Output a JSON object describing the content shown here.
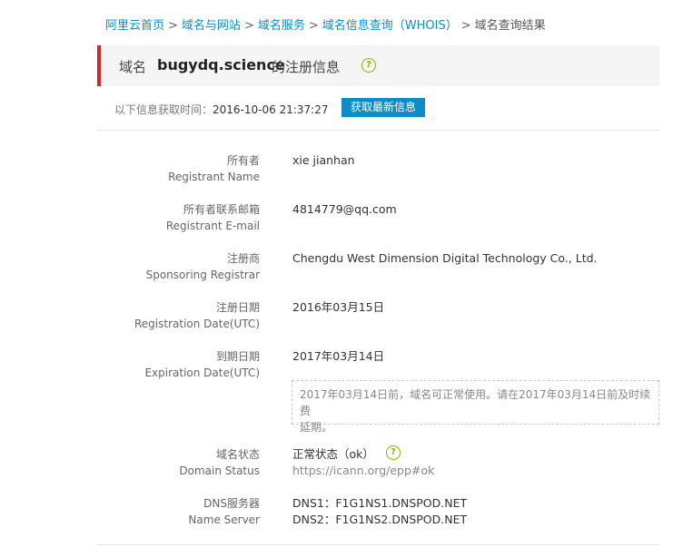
{
  "breadcrumb": {
    "items": [
      "阿里云首页",
      "域名与网站",
      "域名服务",
      "域名信息查询（WHOIS）"
    ],
    "separator": ">",
    "current": "域名查询结果"
  },
  "title": {
    "prefix": "域名",
    "domain": "bugydq.science",
    "suffix": "的注册信息",
    "help_icon": "question-circle-icon"
  },
  "fetch": {
    "label": "以下信息获取时间：",
    "time": "2016-10-06 21:37:27",
    "button": "获取最新信息"
  },
  "registrant": {
    "label_cn": "所有者",
    "label_en": "Registrant Name",
    "value": "xie jianhan"
  },
  "email": {
    "label_cn": "所有者联系邮箱",
    "label_en": "Registrant E-mail",
    "value": "4814779@qq.com"
  },
  "registrar": {
    "label_cn": "注册商",
    "label_en": "Sponsoring Registrar",
    "value": "Chengdu West Dimension Digital Technology Co., Ltd."
  },
  "reg_date": {
    "label_cn": "注册日期",
    "label_en": "Registration Date(UTC)",
    "value": "2016年03月15日"
  },
  "exp_date": {
    "label_cn": "到期日期",
    "label_en": "Expiration Date(UTC)",
    "value": "2017年03月14日",
    "notice_line1": "2017年03月14日前，域名可正常使用。请在2017年03月14日前及时续费",
    "notice_line2": "延期。"
  },
  "status": {
    "label_cn": "域名状态",
    "label_en": "Domain Status",
    "value": "正常状态（ok）",
    "link": "https://icann.org/epp#ok",
    "help_icon": "question-circle-icon"
  },
  "dns": {
    "label_cn": "DNS服务器",
    "label_en": "Name Server",
    "ns1": "DNS1：F1G1NS1.DNSPOD.NET",
    "ns2": "DNS2：F1G1NS2.DNSPOD.NET"
  },
  "colors": {
    "link": "#0e8dc5",
    "accent_bar": "#d9232b",
    "help_icon": "#7fba00",
    "button_bg": "#0e8dc5"
  }
}
